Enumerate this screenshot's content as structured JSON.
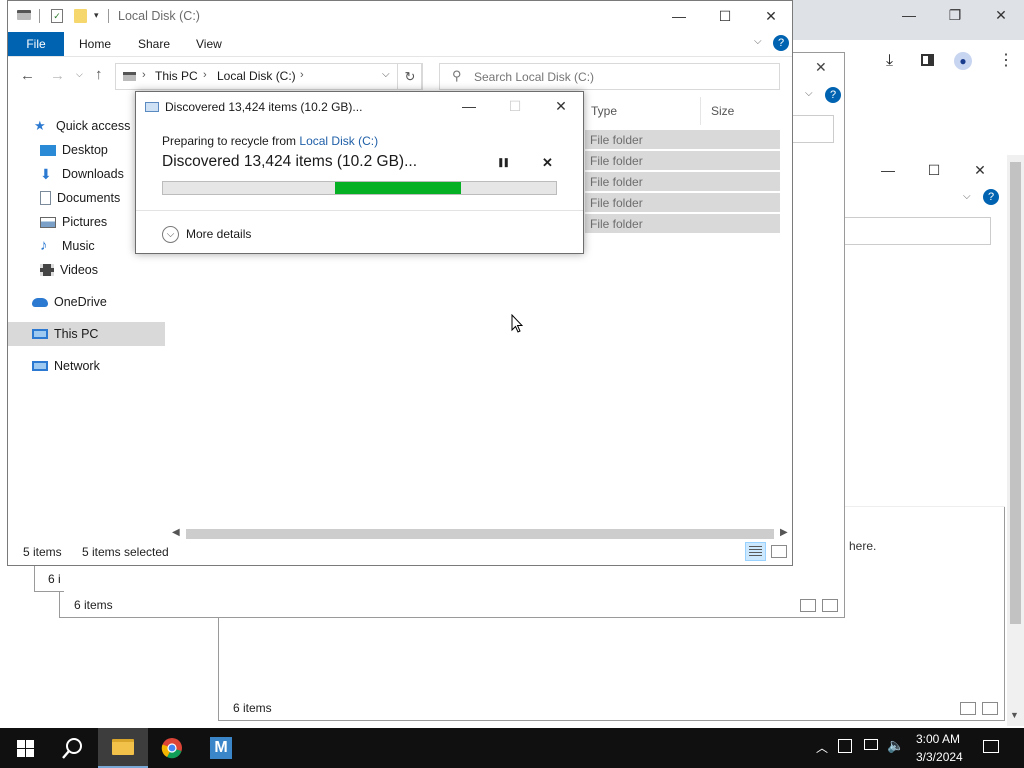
{
  "background_windows": {
    "right_window": {
      "status": "6 items",
      "partial_text": "here."
    },
    "middle_window": {
      "status": "6 items"
    },
    "back_window": {
      "status": "6 i"
    }
  },
  "explorer": {
    "title": "Local Disk (C:)",
    "ribbon_tabs": [
      "File",
      "Home",
      "Share",
      "View"
    ],
    "breadcrumb": [
      "This PC",
      "Local Disk (C:)"
    ],
    "search_placeholder": "Search Local Disk (C:)",
    "columns": {
      "type": "Type",
      "size": "Size"
    },
    "rows": [
      "File folder",
      "File folder",
      "File folder",
      "File folder",
      "File folder"
    ],
    "nav": {
      "quick_access": "Quick access",
      "items": [
        "Desktop",
        "Downloads",
        "Documents",
        "Pictures",
        "Music",
        "Videos"
      ],
      "onedrive": "OneDrive",
      "this_pc": "This PC",
      "network": "Network"
    },
    "status": {
      "count": "5 items",
      "selected": "5 items selected"
    }
  },
  "dialog": {
    "title": "Discovered 13,424 items (10.2 GB)...",
    "preparing_prefix": "Preparing to recycle from ",
    "preparing_link": "Local Disk (C:)",
    "headline": "Discovered 13,424 items (10.2 GB)...",
    "more_details": "More details",
    "progress_fraction": 0.32,
    "pause_glyph": "❚❚",
    "cancel_glyph": "✕"
  },
  "taskbar": {
    "time": "3:00 AM",
    "date": "3/3/2024"
  },
  "colors": {
    "accent": "#0063b1",
    "progress": "#06b025",
    "taskbar": "#101010",
    "selection": "#d9d9d9"
  }
}
